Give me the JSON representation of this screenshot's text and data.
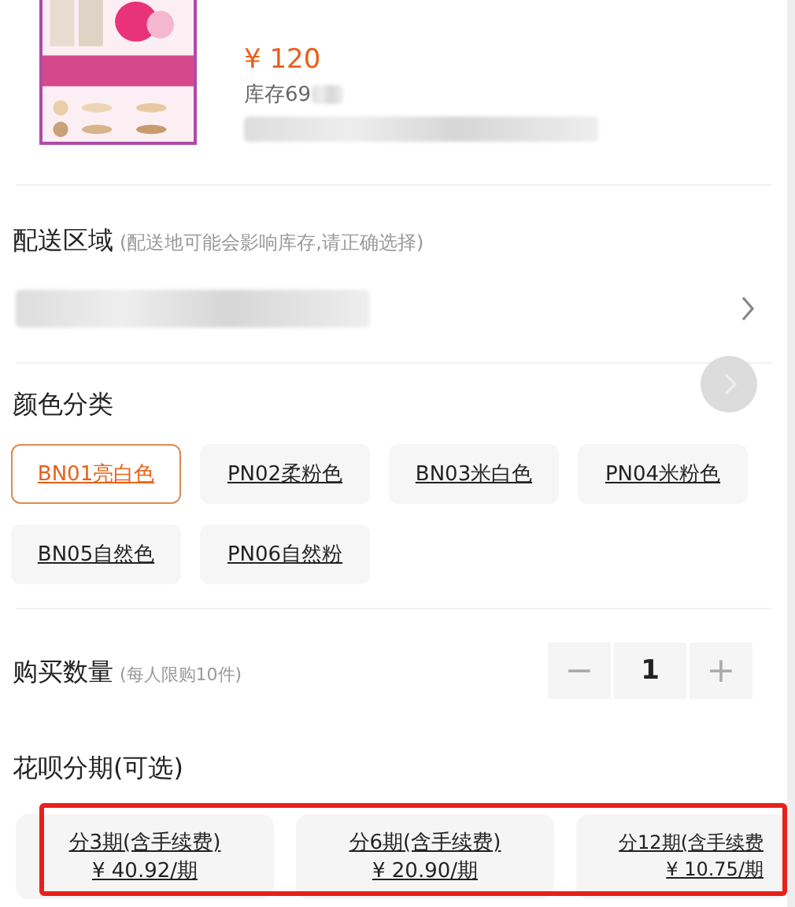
{
  "product": {
    "price": "¥ 120",
    "stock": "库存69"
  },
  "delivery": {
    "title": "配送区域",
    "hint": "(配送地可能会影响库存,请正确选择)"
  },
  "colors": {
    "title": "颜色分类",
    "options": [
      {
        "label": "BN01亮白色",
        "selected": true
      },
      {
        "label": "PN02柔粉色",
        "selected": false
      },
      {
        "label": "BN03米白色",
        "selected": false
      },
      {
        "label": "PN04米粉色",
        "selected": false
      },
      {
        "label": "BN05自然色",
        "selected": false
      },
      {
        "label": "PN06自然粉",
        "selected": false
      }
    ]
  },
  "quantity": {
    "title": "购买数量",
    "hint": "(每人限购10件)",
    "minus": "−",
    "value": "1",
    "plus": "+"
  },
  "installments": {
    "title": "花呗分期(可选)",
    "highlighted": true,
    "options": [
      {
        "label": "分3期(含手续费)",
        "price": "¥ 40.92/期"
      },
      {
        "label": "分6期(含手续费)",
        "price": "¥ 20.90/期"
      },
      {
        "label": "分12期(含手续费",
        "price": "¥ 10.75/期"
      }
    ]
  }
}
